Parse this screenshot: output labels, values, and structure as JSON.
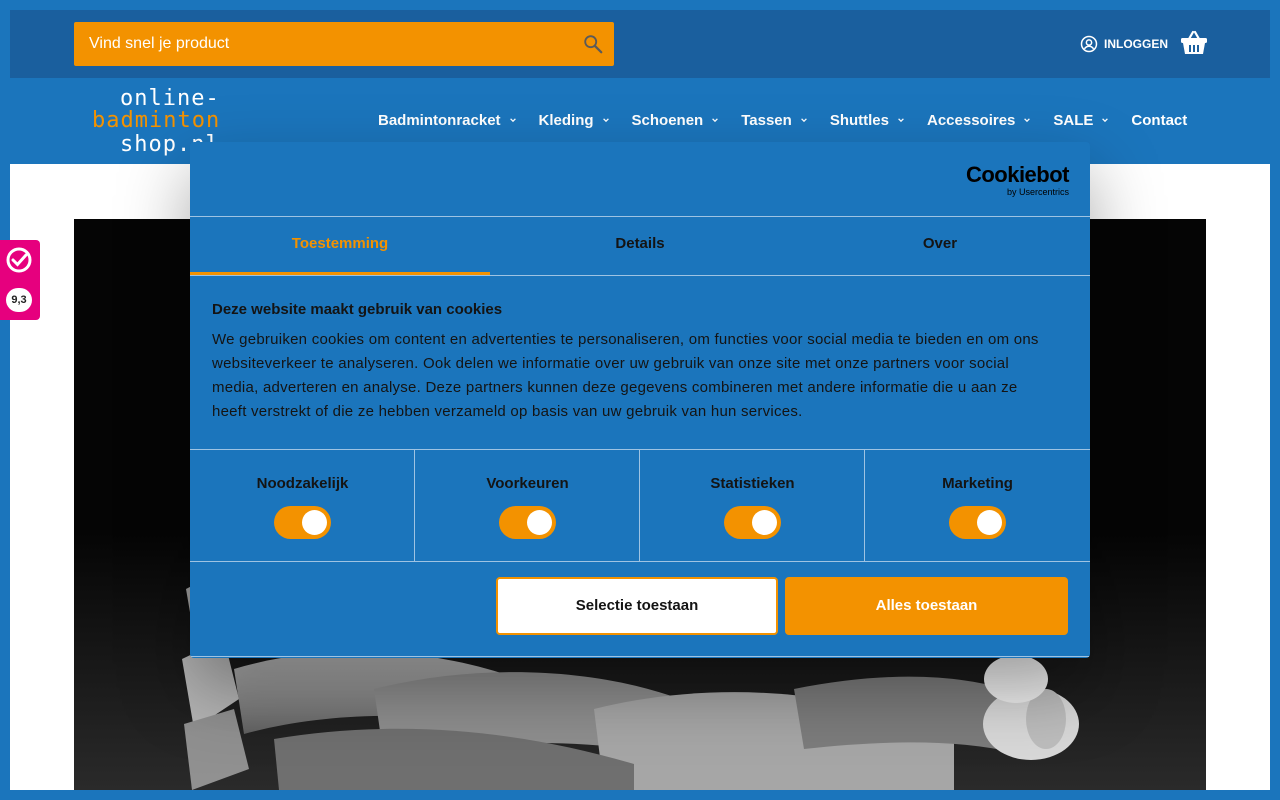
{
  "header": {
    "search": {
      "placeholder": "Vind snel je product"
    },
    "login_label": "INLOGGEN"
  },
  "logo": {
    "line1": "online-",
    "line2": "badminton",
    "line3": "shop.nl"
  },
  "nav": {
    "items": [
      {
        "label": "Badmintonracket",
        "has_dropdown": true
      },
      {
        "label": "Kleding",
        "has_dropdown": true
      },
      {
        "label": "Schoenen",
        "has_dropdown": true
      },
      {
        "label": "Tassen",
        "has_dropdown": true
      },
      {
        "label": "Shuttles",
        "has_dropdown": true
      },
      {
        "label": "Accessoires",
        "has_dropdown": true
      },
      {
        "label": "SALE",
        "has_dropdown": true
      },
      {
        "label": "Contact",
        "has_dropdown": false
      }
    ]
  },
  "rating": {
    "score": "9,3"
  },
  "cookie_dialog": {
    "brand": {
      "name": "Cookiebot",
      "sub": "by Usercentrics"
    },
    "tabs": [
      {
        "label": "Toestemming",
        "active": true
      },
      {
        "label": "Details",
        "active": false
      },
      {
        "label": "Over",
        "active": false
      }
    ],
    "title": "Deze website maakt gebruik van cookies",
    "text": "We gebruiken cookies om content en advertenties te personaliseren, om functies voor social media te bieden en om ons websiteverkeer te analyseren. Ook delen we informatie over uw gebruik van onze site met onze partners voor social media, adverteren en analyse. Deze partners kunnen deze gegevens combineren met andere informatie die u aan ze heeft verstrekt of die ze hebben verzameld op basis van uw gebruik van hun services.",
    "preferences": [
      {
        "label": "Noodzakelijk",
        "enabled": true
      },
      {
        "label": "Voorkeuren",
        "enabled": true
      },
      {
        "label": "Statistieken",
        "enabled": true
      },
      {
        "label": "Marketing",
        "enabled": true
      }
    ],
    "buttons": {
      "allow_selection": "Selectie toestaan",
      "allow_all": "Alles toestaan"
    }
  },
  "colors": {
    "brand_blue": "#1b75bc",
    "topbar_blue": "#1a5f9e",
    "accent_orange": "#f39200",
    "rating_pink": "#e6007e"
  }
}
